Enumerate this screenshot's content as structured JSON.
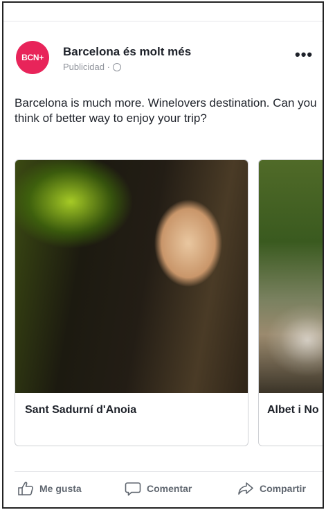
{
  "post": {
    "page_name": "Barcelona és molt més",
    "avatar_text": "BCN+",
    "sponsored_label": "Publicidad ·",
    "more_label": "•••",
    "text": "Barcelona is much more. Winelovers destination. Can you think of better way to enjoy your trip?"
  },
  "carousel": {
    "cards": [
      {
        "title": "Sant Sadurní d'Anoia"
      },
      {
        "title": "Albet i No"
      }
    ]
  },
  "actions": {
    "like": "Me gusta",
    "comment": "Comentar",
    "share": "Compartir"
  },
  "colors": {
    "brand": "#e8245a",
    "text": "#1d2129",
    "muted": "#90949c",
    "action": "#606770"
  },
  "icons": {
    "globe": "globe-icon",
    "like": "thumbs-up-icon",
    "comment": "comment-bubble-icon",
    "share": "share-arrow-icon",
    "more": "more-options-icon"
  }
}
